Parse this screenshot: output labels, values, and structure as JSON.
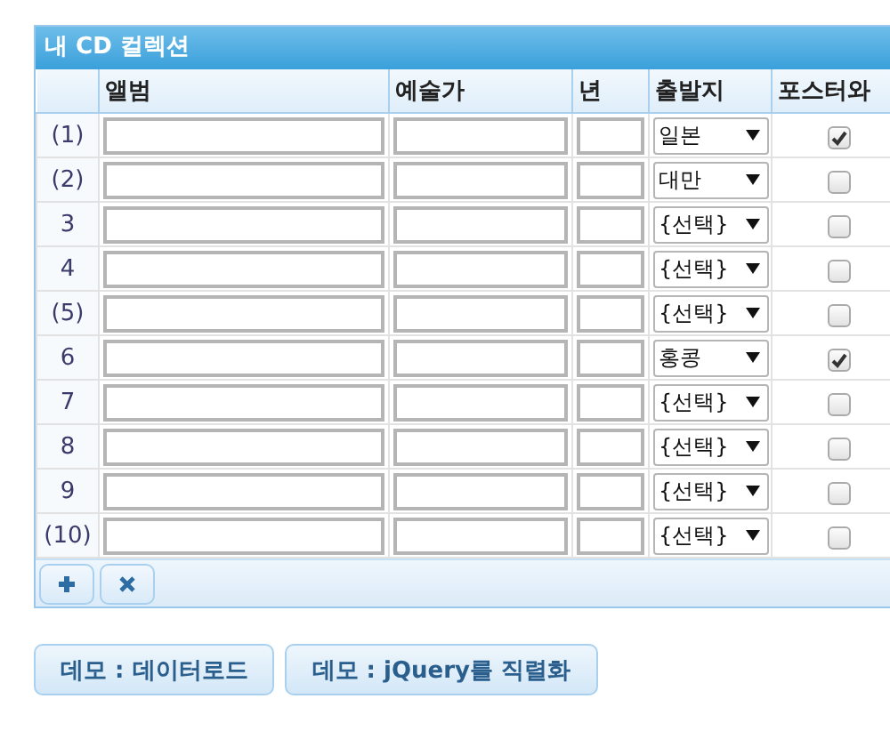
{
  "panel": {
    "title": "내 CD 컬렉션"
  },
  "table": {
    "columns": [
      "앨범",
      "예술가",
      "년",
      "출발지",
      "포스터와"
    ],
    "rows": [
      {
        "row_number": "(1)",
        "origin": "일본",
        "poster": true
      },
      {
        "row_number": "(2)",
        "origin": "대만",
        "poster": false
      },
      {
        "row_number": "3",
        "origin": "{선택}",
        "poster": false
      },
      {
        "row_number": "4",
        "origin": "{선택}",
        "poster": false
      },
      {
        "row_number": "(5)",
        "origin": "{선택}",
        "poster": false
      },
      {
        "row_number": "6",
        "origin": "홍콩",
        "poster": true
      },
      {
        "row_number": "7",
        "origin": "{선택}",
        "poster": false
      },
      {
        "row_number": "8",
        "origin": "{선택}",
        "poster": false
      },
      {
        "row_number": "9",
        "origin": "{선택}",
        "poster": false
      },
      {
        "row_number": "(10)",
        "origin": "{선택}",
        "poster": false
      }
    ]
  },
  "toolbar": [
    {
      "kind": "add"
    },
    {
      "kind": "delete"
    }
  ],
  "buttons": [
    "데모 : 데이터로드",
    "데모 : jQuery를 직렬화"
  ]
}
